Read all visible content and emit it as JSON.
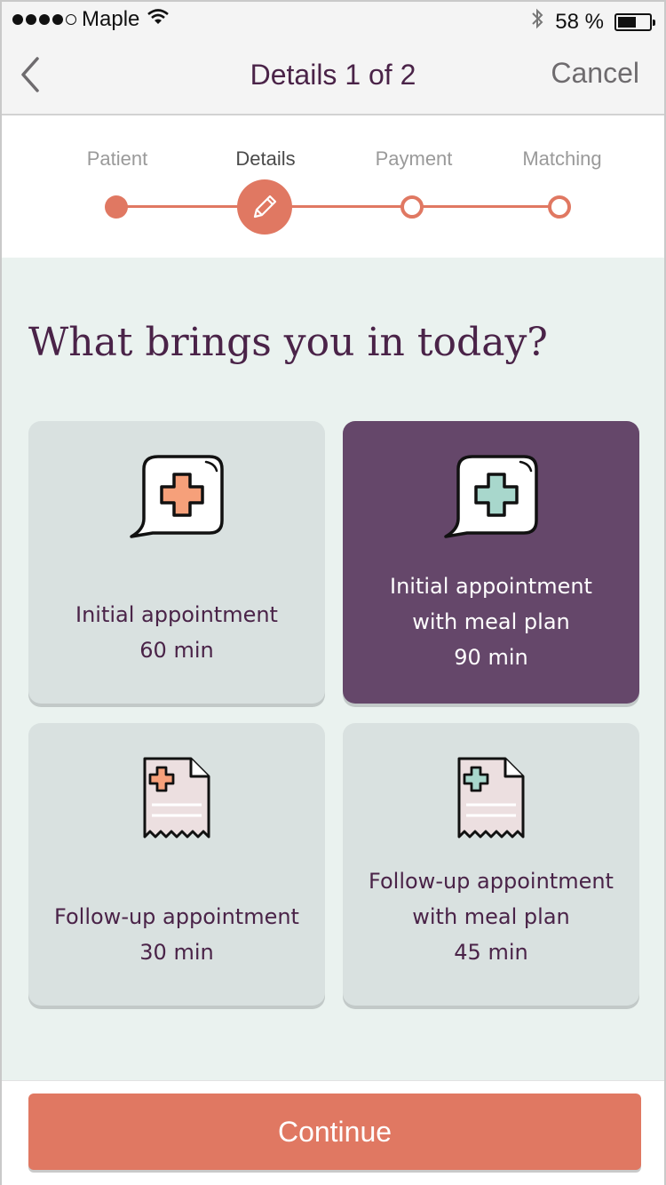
{
  "status_bar": {
    "carrier": "Maple",
    "battery_text": "58 %",
    "battery_level": 0.58,
    "icons": [
      "signal-dots-icon",
      "wifi-icon",
      "bluetooth-icon",
      "battery-icon"
    ]
  },
  "nav": {
    "title": "Details 1 of 2",
    "cancel_label": "Cancel",
    "back_icon": "chevron-left-icon"
  },
  "stepper": {
    "steps": [
      {
        "label": "Patient",
        "state": "done"
      },
      {
        "label": "Details",
        "state": "active"
      },
      {
        "label": "Payment",
        "state": "pending"
      },
      {
        "label": "Matching",
        "state": "pending"
      }
    ],
    "active_icon": "pencil-icon"
  },
  "main": {
    "heading": "What brings you in today?",
    "options": [
      {
        "line1": "Initial appointment",
        "line2": "",
        "duration": "60 min",
        "icon": "chat-medical-icon",
        "selected": false
      },
      {
        "line1": "Initial appointment",
        "line2": "with meal plan",
        "duration": "90 min",
        "icon": "chat-medical-icon",
        "selected": true
      },
      {
        "line1": "Follow-up appointment",
        "line2": "",
        "duration": "30 min",
        "icon": "medical-receipt-icon",
        "selected": false
      },
      {
        "line1": "Follow-up appointment",
        "line2": "with meal plan",
        "duration": "45 min",
        "icon": "medical-receipt-icon",
        "selected": false
      }
    ]
  },
  "footer": {
    "continue_label": "Continue"
  },
  "colors": {
    "accent": "#e07862",
    "brand_purple": "#4a2348",
    "selected_card": "#65476a",
    "card_bg": "#d9e1e0",
    "content_bg": "#eaf2ef",
    "plus_orange": "#f6a07a",
    "plus_mint": "#a8d7cc"
  }
}
